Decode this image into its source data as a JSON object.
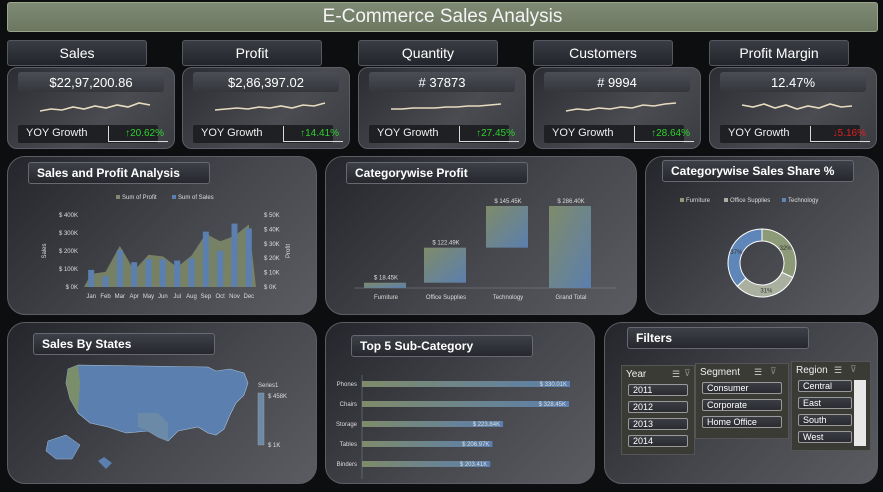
{
  "title": "E-Commerce Sales Analysis",
  "kpis": [
    {
      "label": "Sales",
      "value": "$22,97,200.86",
      "yoy_label": "YOY Growth",
      "yoy": "↑20.62%",
      "yoy_color": "#2ed12e"
    },
    {
      "label": "Profit",
      "value": "$2,86,397.02",
      "yoy_label": "YOY Growth",
      "yoy": "↑14.41%",
      "yoy_color": "#2ed12e"
    },
    {
      "label": "Quantity",
      "value": "# 37873",
      "yoy_label": "YOY Growth",
      "yoy": "↑27.45%",
      "yoy_color": "#2ed12e"
    },
    {
      "label": "Customers",
      "value": "# 9994",
      "yoy_label": "YOY Growth",
      "yoy": "↑28.64%",
      "yoy_color": "#2ed12e"
    },
    {
      "label": "Profit Margin",
      "value": "12.47%",
      "yoy_label": "YOY Growth",
      "yoy": "↓5.16%",
      "yoy_color": "#e02020"
    }
  ],
  "panels": {
    "sales_profit": "Sales and Profit Analysis",
    "category_profit": "Categorywise Profit",
    "category_share": "Categorywise Sales Share %",
    "states": "Sales By States",
    "top5": "Top 5 Sub-Category",
    "filters": "Filters"
  },
  "chart_data": [
    {
      "type": "bar",
      "title": "Sales and Profit Analysis",
      "legend": [
        "Sum of Profit",
        "Sum of Sales"
      ],
      "ylabel": "Sales",
      "y2label": "Profit",
      "categories": [
        "Jan",
        "Feb",
        "Mar",
        "Apr",
        "May",
        "Jun",
        "Jul",
        "Aug",
        "Sep",
        "Oct",
        "Nov",
        "Dec"
      ],
      "series": [
        {
          "name": "Sum of Profit",
          "values": [
            9100,
            10500,
            28600,
            11500,
            22400,
            21300,
            13800,
            21800,
            36900,
            31800,
            35400,
            43400
          ]
        },
        {
          "name": "Sum of Sales",
          "values": [
            94900,
            59800,
            205000,
            137800,
            155000,
            152700,
            147200,
            159000,
            307600,
            200300,
            352500,
            325300
          ]
        }
      ],
      "ylim": [
        0,
        400000
      ],
      "yticks": [
        "$ 0K",
        "$ 100K",
        "$ 200K",
        "$ 300K",
        "$ 400K"
      ],
      "y2lim": [
        0,
        50000
      ],
      "y2ticks": [
        "$ 0K",
        "$ 10K",
        "$ 20K",
        "$ 30K",
        "$ 40K",
        "$ 50K"
      ]
    },
    {
      "type": "bar",
      "title": "Categorywise Profit",
      "categories": [
        "Furniture",
        "Office Supplies",
        "Technology",
        "Grand Total"
      ],
      "values": [
        18450,
        122490,
        145450,
        286400
      ],
      "labels": [
        "$ 18.45K",
        "$ 122.49K",
        "$ 145.45K",
        "$ 286.40K"
      ],
      "waterfall": true
    },
    {
      "type": "pie",
      "title": "Categorywise Sales Share %",
      "categories": [
        "Furniture",
        "Office Supplies",
        "Technology"
      ],
      "values": [
        32,
        31,
        37
      ],
      "labels": [
        "32%",
        "31%",
        "37%"
      ],
      "colors": [
        "#8d9a78",
        "#aab0a0",
        "#5e86b8"
      ]
    },
    {
      "type": "bar",
      "title": "Top 5 Sub-Category",
      "categories": [
        "Phones",
        "Chairs",
        "Storage",
        "Tables",
        "Binders"
      ],
      "values": [
        330010,
        328450,
        223840,
        206970,
        203410
      ],
      "labels": [
        "$ 330.01K",
        "$ 328.45K",
        "$ 223.84K",
        "$ 206.97K",
        "$ 203.41K"
      ]
    }
  ],
  "map": {
    "legend_title": "Series1",
    "legend_max": "$ 458K",
    "legend_min": "$ 1K"
  },
  "filters": {
    "year": {
      "label": "Year",
      "items": [
        "2011",
        "2012",
        "2013",
        "2014"
      ]
    },
    "segment": {
      "label": "Segment",
      "items": [
        "Consumer",
        "Corporate",
        "Home Office"
      ]
    },
    "region": {
      "label": "Region",
      "items": [
        "Central",
        "East",
        "South",
        "West"
      ]
    }
  },
  "colors": {
    "profit_line": "#7f8b6a",
    "sales_bar": "#5b7fae",
    "sparkline": "#e8dcc0"
  }
}
